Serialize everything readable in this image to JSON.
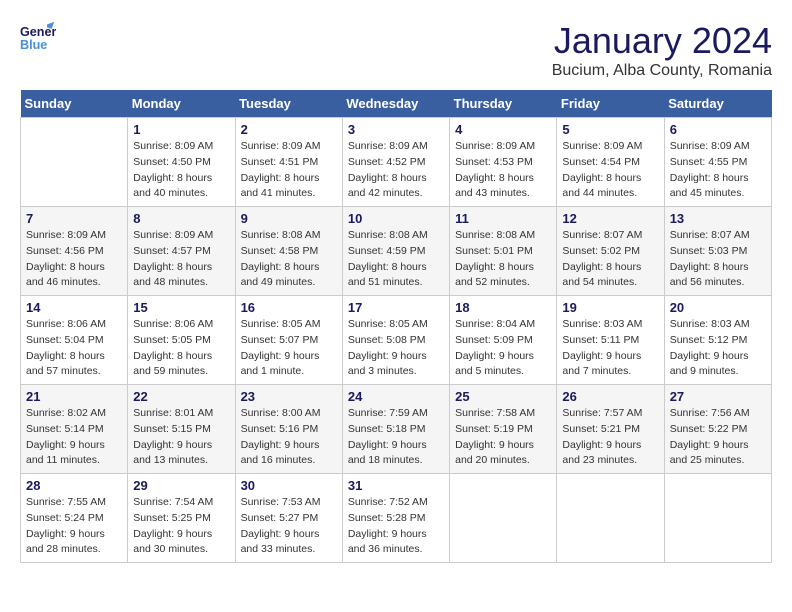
{
  "header": {
    "logo_line1": "General",
    "logo_line2": "Blue",
    "month": "January 2024",
    "location": "Bucium, Alba County, Romania"
  },
  "days_of_week": [
    "Sunday",
    "Monday",
    "Tuesday",
    "Wednesday",
    "Thursday",
    "Friday",
    "Saturday"
  ],
  "weeks": [
    [
      {
        "num": "",
        "sunrise": "",
        "sunset": "",
        "daylight": ""
      },
      {
        "num": "1",
        "sunrise": "Sunrise: 8:09 AM",
        "sunset": "Sunset: 4:50 PM",
        "daylight": "Daylight: 8 hours and 40 minutes."
      },
      {
        "num": "2",
        "sunrise": "Sunrise: 8:09 AM",
        "sunset": "Sunset: 4:51 PM",
        "daylight": "Daylight: 8 hours and 41 minutes."
      },
      {
        "num": "3",
        "sunrise": "Sunrise: 8:09 AM",
        "sunset": "Sunset: 4:52 PM",
        "daylight": "Daylight: 8 hours and 42 minutes."
      },
      {
        "num": "4",
        "sunrise": "Sunrise: 8:09 AM",
        "sunset": "Sunset: 4:53 PM",
        "daylight": "Daylight: 8 hours and 43 minutes."
      },
      {
        "num": "5",
        "sunrise": "Sunrise: 8:09 AM",
        "sunset": "Sunset: 4:54 PM",
        "daylight": "Daylight: 8 hours and 44 minutes."
      },
      {
        "num": "6",
        "sunrise": "Sunrise: 8:09 AM",
        "sunset": "Sunset: 4:55 PM",
        "daylight": "Daylight: 8 hours and 45 minutes."
      }
    ],
    [
      {
        "num": "7",
        "sunrise": "Sunrise: 8:09 AM",
        "sunset": "Sunset: 4:56 PM",
        "daylight": "Daylight: 8 hours and 46 minutes."
      },
      {
        "num": "8",
        "sunrise": "Sunrise: 8:09 AM",
        "sunset": "Sunset: 4:57 PM",
        "daylight": "Daylight: 8 hours and 48 minutes."
      },
      {
        "num": "9",
        "sunrise": "Sunrise: 8:08 AM",
        "sunset": "Sunset: 4:58 PM",
        "daylight": "Daylight: 8 hours and 49 minutes."
      },
      {
        "num": "10",
        "sunrise": "Sunrise: 8:08 AM",
        "sunset": "Sunset: 4:59 PM",
        "daylight": "Daylight: 8 hours and 51 minutes."
      },
      {
        "num": "11",
        "sunrise": "Sunrise: 8:08 AM",
        "sunset": "Sunset: 5:01 PM",
        "daylight": "Daylight: 8 hours and 52 minutes."
      },
      {
        "num": "12",
        "sunrise": "Sunrise: 8:07 AM",
        "sunset": "Sunset: 5:02 PM",
        "daylight": "Daylight: 8 hours and 54 minutes."
      },
      {
        "num": "13",
        "sunrise": "Sunrise: 8:07 AM",
        "sunset": "Sunset: 5:03 PM",
        "daylight": "Daylight: 8 hours and 56 minutes."
      }
    ],
    [
      {
        "num": "14",
        "sunrise": "Sunrise: 8:06 AM",
        "sunset": "Sunset: 5:04 PM",
        "daylight": "Daylight: 8 hours and 57 minutes."
      },
      {
        "num": "15",
        "sunrise": "Sunrise: 8:06 AM",
        "sunset": "Sunset: 5:05 PM",
        "daylight": "Daylight: 8 hours and 59 minutes."
      },
      {
        "num": "16",
        "sunrise": "Sunrise: 8:05 AM",
        "sunset": "Sunset: 5:07 PM",
        "daylight": "Daylight: 9 hours and 1 minute."
      },
      {
        "num": "17",
        "sunrise": "Sunrise: 8:05 AM",
        "sunset": "Sunset: 5:08 PM",
        "daylight": "Daylight: 9 hours and 3 minutes."
      },
      {
        "num": "18",
        "sunrise": "Sunrise: 8:04 AM",
        "sunset": "Sunset: 5:09 PM",
        "daylight": "Daylight: 9 hours and 5 minutes."
      },
      {
        "num": "19",
        "sunrise": "Sunrise: 8:03 AM",
        "sunset": "Sunset: 5:11 PM",
        "daylight": "Daylight: 9 hours and 7 minutes."
      },
      {
        "num": "20",
        "sunrise": "Sunrise: 8:03 AM",
        "sunset": "Sunset: 5:12 PM",
        "daylight": "Daylight: 9 hours and 9 minutes."
      }
    ],
    [
      {
        "num": "21",
        "sunrise": "Sunrise: 8:02 AM",
        "sunset": "Sunset: 5:14 PM",
        "daylight": "Daylight: 9 hours and 11 minutes."
      },
      {
        "num": "22",
        "sunrise": "Sunrise: 8:01 AM",
        "sunset": "Sunset: 5:15 PM",
        "daylight": "Daylight: 9 hours and 13 minutes."
      },
      {
        "num": "23",
        "sunrise": "Sunrise: 8:00 AM",
        "sunset": "Sunset: 5:16 PM",
        "daylight": "Daylight: 9 hours and 16 minutes."
      },
      {
        "num": "24",
        "sunrise": "Sunrise: 7:59 AM",
        "sunset": "Sunset: 5:18 PM",
        "daylight": "Daylight: 9 hours and 18 minutes."
      },
      {
        "num": "25",
        "sunrise": "Sunrise: 7:58 AM",
        "sunset": "Sunset: 5:19 PM",
        "daylight": "Daylight: 9 hours and 20 minutes."
      },
      {
        "num": "26",
        "sunrise": "Sunrise: 7:57 AM",
        "sunset": "Sunset: 5:21 PM",
        "daylight": "Daylight: 9 hours and 23 minutes."
      },
      {
        "num": "27",
        "sunrise": "Sunrise: 7:56 AM",
        "sunset": "Sunset: 5:22 PM",
        "daylight": "Daylight: 9 hours and 25 minutes."
      }
    ],
    [
      {
        "num": "28",
        "sunrise": "Sunrise: 7:55 AM",
        "sunset": "Sunset: 5:24 PM",
        "daylight": "Daylight: 9 hours and 28 minutes."
      },
      {
        "num": "29",
        "sunrise": "Sunrise: 7:54 AM",
        "sunset": "Sunset: 5:25 PM",
        "daylight": "Daylight: 9 hours and 30 minutes."
      },
      {
        "num": "30",
        "sunrise": "Sunrise: 7:53 AM",
        "sunset": "Sunset: 5:27 PM",
        "daylight": "Daylight: 9 hours and 33 minutes."
      },
      {
        "num": "31",
        "sunrise": "Sunrise: 7:52 AM",
        "sunset": "Sunset: 5:28 PM",
        "daylight": "Daylight: 9 hours and 36 minutes."
      },
      {
        "num": "",
        "sunrise": "",
        "sunset": "",
        "daylight": ""
      },
      {
        "num": "",
        "sunrise": "",
        "sunset": "",
        "daylight": ""
      },
      {
        "num": "",
        "sunrise": "",
        "sunset": "",
        "daylight": ""
      }
    ]
  ]
}
